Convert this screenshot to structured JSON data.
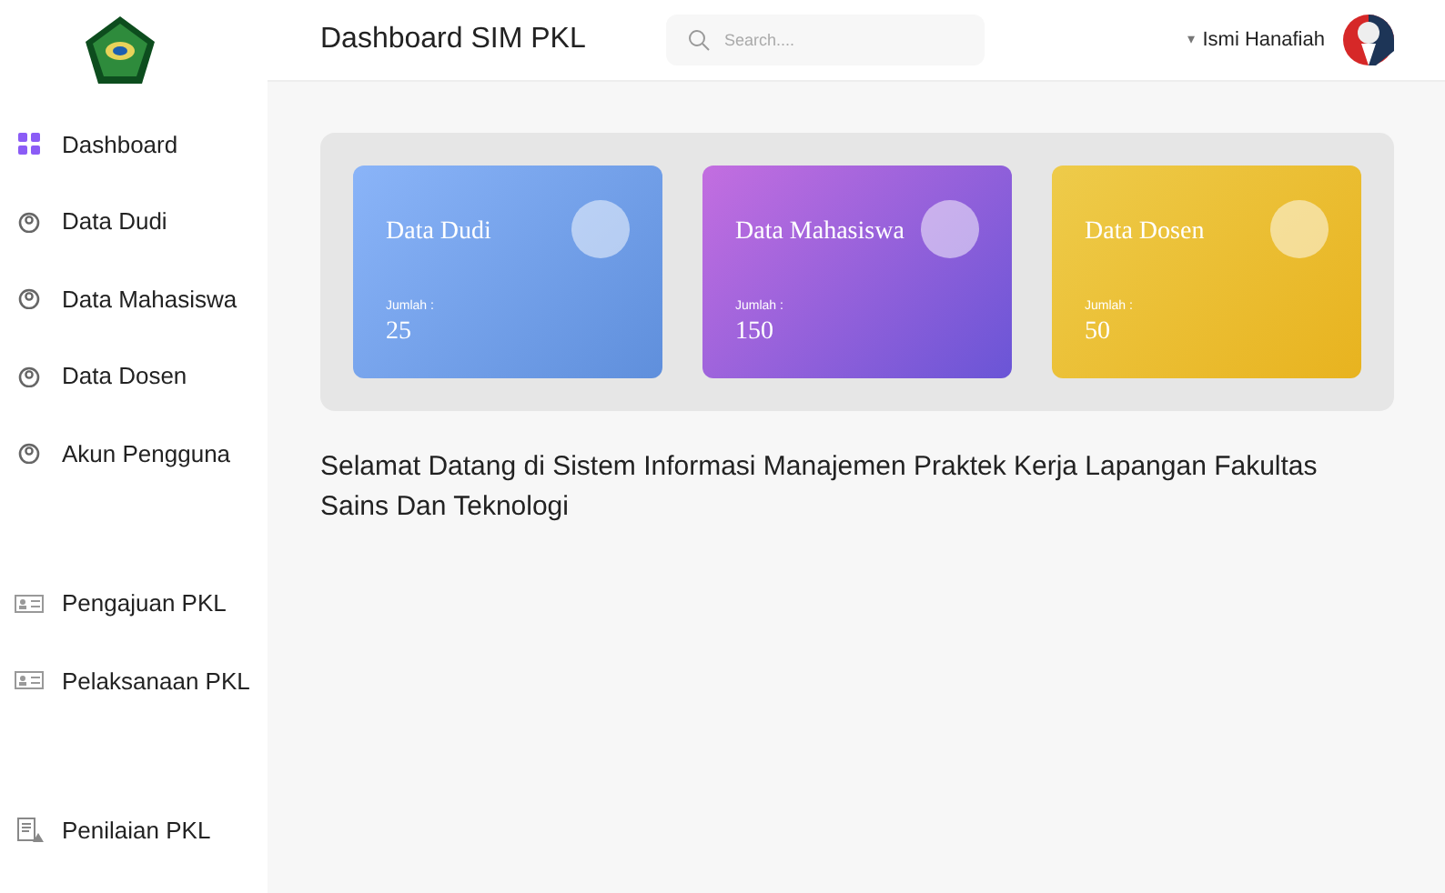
{
  "header": {
    "title": "Dashboard SIM PKL",
    "search": {
      "placeholder": "Search...."
    },
    "user": {
      "caret": "▾",
      "name": "Ismi Hanafiah"
    }
  },
  "sidebar": {
    "groups": [
      {
        "items": [
          {
            "label": "Dashboard",
            "kind": "grid"
          },
          {
            "label": "Data Dudi",
            "kind": "user"
          },
          {
            "label": "Data Mahasiswa",
            "kind": "user"
          },
          {
            "label": "Data Dosen",
            "kind": "user"
          },
          {
            "label": "Akun Pengguna",
            "kind": "user"
          }
        ]
      },
      {
        "items": [
          {
            "label": "Pengajuan PKL",
            "kind": "card"
          },
          {
            "label": "Pelaksanaan PKL",
            "kind": "card"
          }
        ]
      },
      {
        "items": [
          {
            "label": "Penilaian PKL",
            "kind": "report"
          }
        ]
      }
    ]
  },
  "cards": [
    {
      "title": "Data Dudi",
      "count_label": "Jumlah :",
      "count": "25",
      "color": "#8ab4f8"
    },
    {
      "title": "Data Mahasiswa",
      "count_label": "Jumlah :",
      "count": "150",
      "color": "#c36ee0"
    },
    {
      "title": "Data Dosen",
      "count_label": "Jumlah :",
      "count": "50",
      "color": "#eecb4a"
    }
  ],
  "welcome": "Selamat Datang di Sistem Informasi Manajemen Praktek Kerja Lapangan Fakultas Sains Dan Teknologi"
}
